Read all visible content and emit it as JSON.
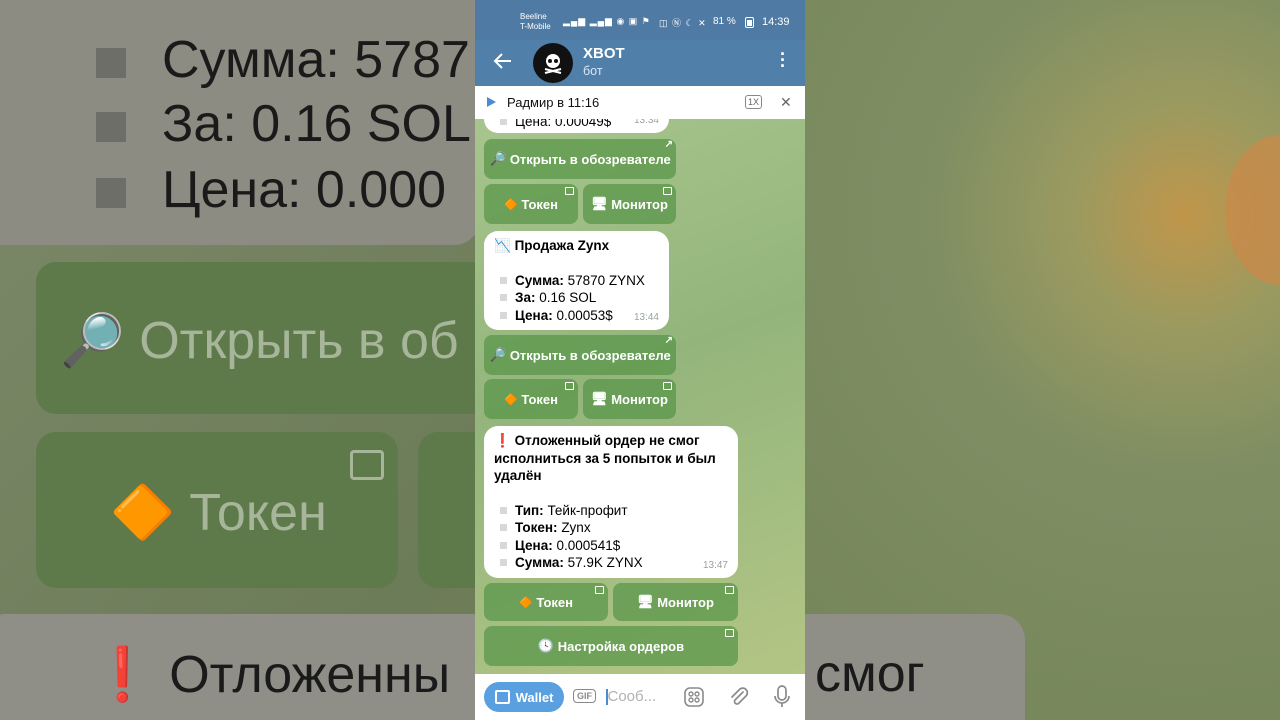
{
  "background": {
    "line1": "Сумма: 5787",
    "line2": "За: 0.16 SOL",
    "line3": "Цена: 0.000",
    "open_btn": "Открыть в об",
    "token_btn": "Токен",
    "bottom_text": "Отложенны",
    "bottom_text2": "смог"
  },
  "status": {
    "carrier1": "Beeline",
    "carrier2": "T-Mobile",
    "battery": "81 %",
    "time": "14:39"
  },
  "header": {
    "title": "XBOT",
    "subtitle": "бот"
  },
  "pinned": {
    "text": "Радмир в 11:16",
    "speed": "1X"
  },
  "messages": {
    "m1": {
      "price": "Цена: 0.00049$",
      "time": "13:34"
    },
    "m2": {
      "title": "Продажа Zynx",
      "sum_label": "Сумма:",
      "sum_value": " 57870 ZYNX",
      "for_label": "За:",
      "for_value": " 0.16 SOL",
      "price_label": "Цена:",
      "price_value": " 0.00053$",
      "time": "13:44"
    },
    "m3": {
      "title": "Отложенный ордер не смог исполниться за 5 попыток и был удалён",
      "type_label": "Тип:",
      "type_value": " Тейк-профит",
      "token_label": "Токен:",
      "token_value": " Zynx",
      "price_label": "Цена:",
      "price_value": " 0.000541$",
      "sum_label": "Сумма:",
      "sum_value": " 57.9K ZYNX",
      "time": "13:47"
    }
  },
  "buttons": {
    "open_browser": "Открыть в обозревателе",
    "token": "Токен",
    "monitor": "Монитор",
    "order_settings": "Настройка ордеров"
  },
  "input": {
    "wallet": "Wallet",
    "gif": "GIF",
    "placeholder": "Сооб..."
  },
  "colors": {
    "header": "#5080aa",
    "button": "#58944a",
    "wallet": "#5aa0e0"
  }
}
